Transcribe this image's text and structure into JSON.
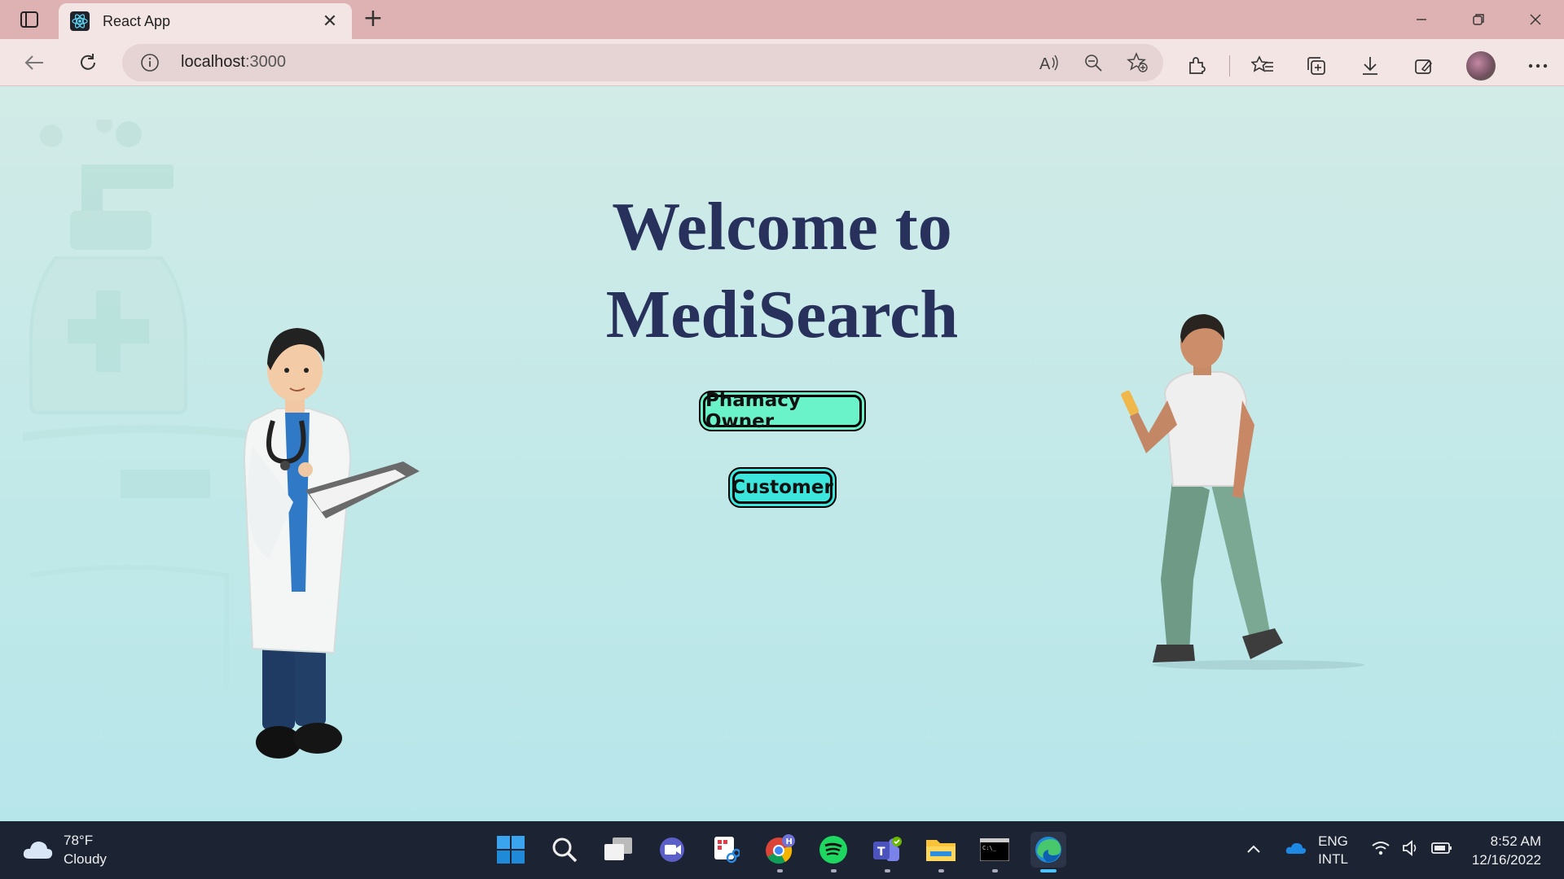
{
  "browser": {
    "tab_title": "React App",
    "url_host": "localhost",
    "url_port": ":3000"
  },
  "page": {
    "heading_line1": "Welcome to",
    "heading_line2": "MediSearch",
    "owner_button": "Phamacy Owner",
    "customer_button": "Customer"
  },
  "taskbar": {
    "weather_temp": "78°F",
    "weather_desc": "Cloudy",
    "lang_line1": "ENG",
    "lang_line2": "INTL",
    "time": "8:52 AM",
    "date": "12/16/2022",
    "apps": [
      "windows-start",
      "search",
      "task-view",
      "chat",
      "snipping-tool",
      "chrome",
      "spotify",
      "teams",
      "file-explorer",
      "terminal",
      "edge"
    ]
  },
  "colors": {
    "heading": "#28305c",
    "owner_button_bg": "#6af2c8",
    "customer_button_bg": "#3ce6dc",
    "taskbar_bg": "#1c2333",
    "chrome_bg": "#deb2b2"
  }
}
